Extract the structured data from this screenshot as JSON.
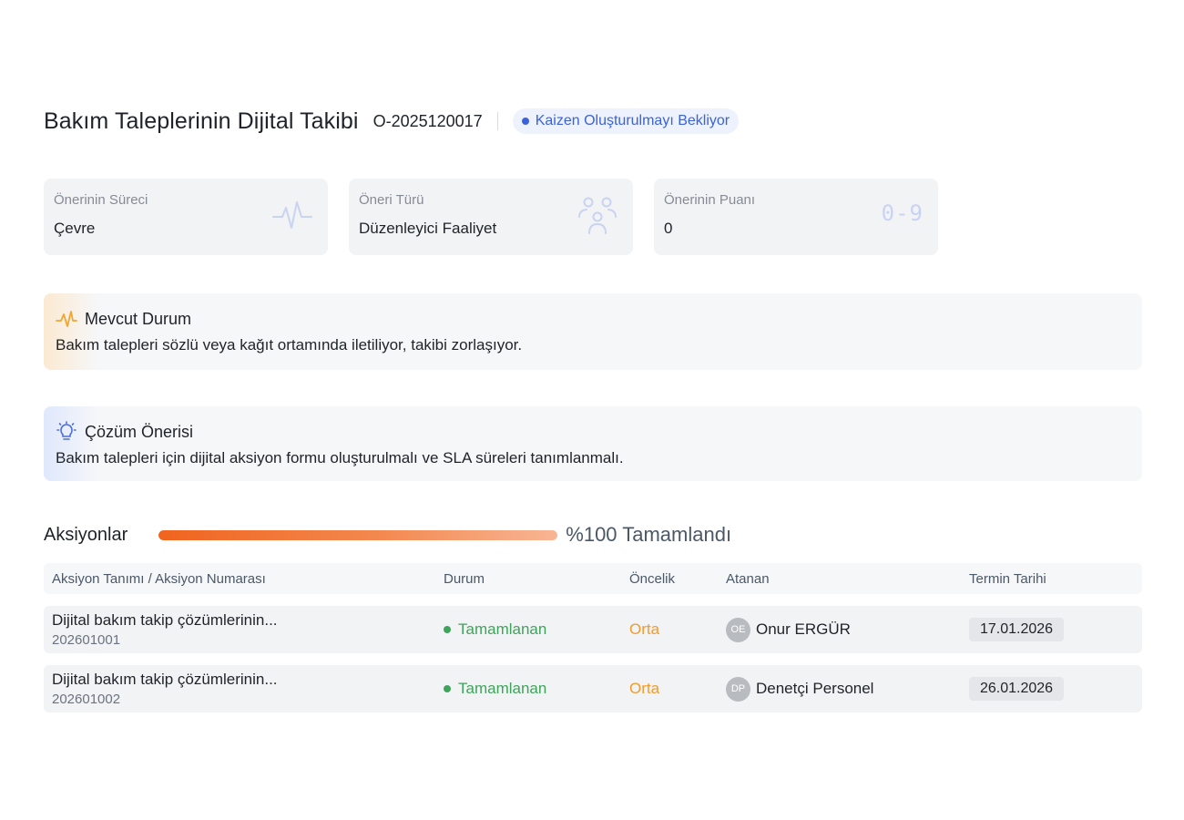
{
  "header": {
    "title": "Bakım Taleplerinin Dijital Takibi",
    "code": "O-2025120017",
    "status": "Kaizen Oluşturulmayı Bekliyor"
  },
  "cards": [
    {
      "label": "Önerinin Süreci",
      "value": "Çevre",
      "icon": "pulse-icon"
    },
    {
      "label": "Öneri Türü",
      "value": "Düzenleyici Faaliyet",
      "icon": "team-icon"
    },
    {
      "label": "Önerinin Puanı",
      "value": "0",
      "icon_text": "0-9"
    }
  ],
  "current_state": {
    "title": "Mevcut Durum",
    "text": "Bakım talepleri sözlü veya kağıt ortamında iletiliyor, takibi zorlaşıyor.",
    "icon": "pulse-icon"
  },
  "solution": {
    "title": "Çözüm Önerisi",
    "text": "Bakım talepleri için dijital aksiyon formu oluşturulmalı ve SLA süreleri tanımlanmalı.",
    "icon": "lightbulb-icon"
  },
  "actions": {
    "title": "Aksiyonlar",
    "progress_percent": 100,
    "progress_label": "%100 Tamamlandı",
    "columns": [
      "Aksiyon Tanımı / Aksiyon Numarası",
      "Durum",
      "Öncelik",
      "Atanan",
      "Termin Tarihi"
    ],
    "rows": [
      {
        "name": "Dijital bakım takip çözümlerinin...",
        "number": "202601001",
        "status": "Tamamlanan",
        "priority": "Orta",
        "assignee_initials": "OE",
        "assignee": "Onur ERGÜR",
        "due": "17.01.2026"
      },
      {
        "name": "Dijital bakım takip çözümlerinin...",
        "number": "202601002",
        "status": "Tamamlanan",
        "priority": "Orta",
        "assignee_initials": "DP",
        "assignee": "Denetçi Personel",
        "due": "26.01.2026"
      }
    ]
  },
  "colors": {
    "status_blue": "#3b63d9",
    "done_green": "#3fa45b",
    "priority_orange": "#f39a2b",
    "progress_orange": "#f0641e"
  }
}
